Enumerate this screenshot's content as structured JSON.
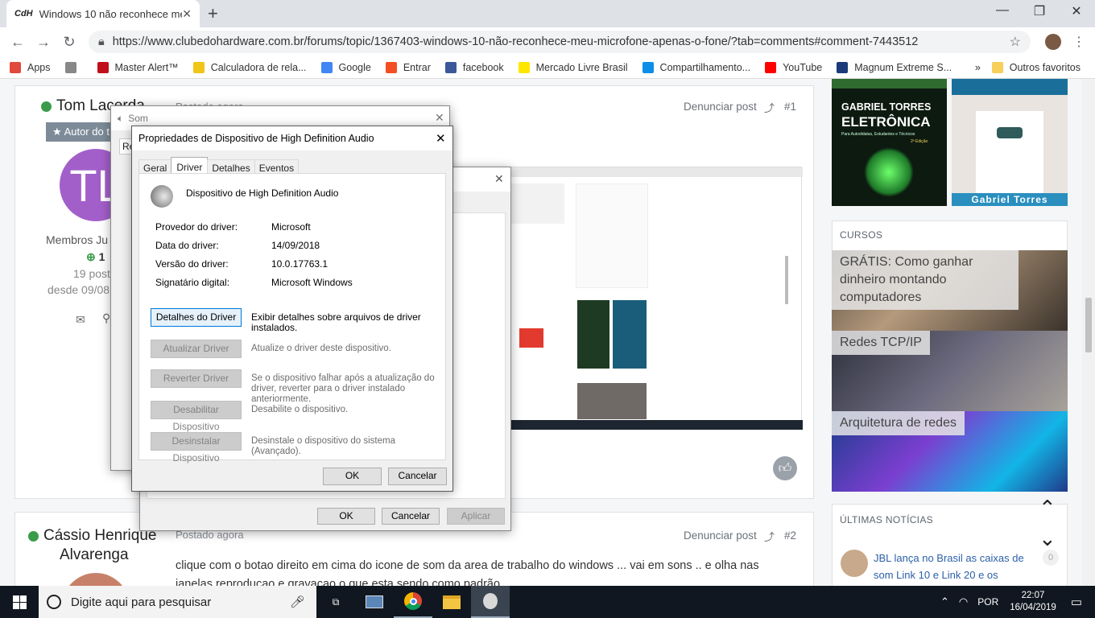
{
  "browser": {
    "tab_title": "Windows 10 não reconhece meu",
    "tab_favicon": "CdH",
    "url": "https://www.clubedohardware.com.br/forums/topic/1367403-windows-10-não-reconhece-meu-microfone-apenas-o-fone/?tab=comments#comment-7443512",
    "bookmarks": [
      {
        "label": "Apps",
        "icon": "apps-grid-icon",
        "color": "#e0493c"
      },
      {
        "label": "",
        "icon": "page-icon",
        "color": "#888888"
      },
      {
        "label": "Master Alert™",
        "icon": "master-alert-icon",
        "color": "#c0101a"
      },
      {
        "label": "Calculadora de rela...",
        "icon": "warning-icon",
        "color": "#f0c419"
      },
      {
        "label": "Google",
        "icon": "google-icon",
        "color": "#4285f4"
      },
      {
        "label": "Entrar",
        "icon": "windows-logo-icon",
        "color": "#f25022"
      },
      {
        "label": "facebook",
        "icon": "facebook-icon",
        "color": "#3b5998"
      },
      {
        "label": "Mercado Livre Brasil",
        "icon": "mercadolivre-icon",
        "color": "#ffe600"
      },
      {
        "label": "Compartilhamento...",
        "icon": "teamviewer-icon",
        "color": "#0e8ee9"
      },
      {
        "label": "YouTube",
        "icon": "youtube-icon",
        "color": "#ff0000"
      },
      {
        "label": "Magnum Extreme S...",
        "icon": "magnum-icon",
        "color": "#1a3a7a"
      }
    ],
    "bookmarks_overflow": "»",
    "other_favorites": "Outros favoritos"
  },
  "post1": {
    "author": "Tom Lacerda",
    "posted": "Postado agora",
    "badge": "Autor do t",
    "avatar_initials": "TL",
    "group": "Membros Ju",
    "reputation": "1",
    "posts": "19 post",
    "since": "desde 09/08",
    "report": "Denunciar post",
    "number": "#1"
  },
  "post2": {
    "author_line1": "Cássio Henrique",
    "author_line2": "Alvarenga",
    "posted": "Postado agora",
    "report": "Denunciar post",
    "number": "#2",
    "text_line1": "clique com o botao direito em cima do icone de som da area de trabalho do windows ... vai em sons .. e olha nas",
    "text_line2": "janelas reproducao e gravacao o que esta sendo como padrão"
  },
  "sidebar": {
    "book1_author": "GABRIEL TORRES",
    "book1_title": "ELETRÔNICA",
    "book1_sub": "Para Autodidatas, Estudantes e Técnicos",
    "book1_edition": "2ª Edição",
    "book2_author": "Gabriel Torres",
    "courses_title": "CURSOS",
    "courses": [
      "GRÁTIS: Como ganhar dinheiro montando computadores",
      "Redes TCP/IP",
      "Arquitetura de redes"
    ],
    "news_title": "ÚLTIMAS NOTÍCIAS",
    "news_item": "JBL lança no Brasil as caixas de som Link 10 e Link 20 e os",
    "news_count": "0"
  },
  "som_dialog": {
    "title": "Som",
    "tab_partial": "Re",
    "ok": "OK",
    "cancel": "Cancelar",
    "apply": "Aplicar"
  },
  "props_dialog": {
    "title": "Propriedades de Dispositivo de High Definition Audio",
    "tabs": [
      "Geral",
      "Driver",
      "Detalhes",
      "Eventos"
    ],
    "device_name": "Dispositivo de High Definition Audio",
    "rows": [
      {
        "label": "Provedor do driver:",
        "value": "Microsoft"
      },
      {
        "label": "Data do driver:",
        "value": "14/09/2018"
      },
      {
        "label": "Versão do driver:",
        "value": "10.0.17763.1"
      },
      {
        "label": "Signatário digital:",
        "value": "Microsoft Windows"
      }
    ],
    "actions": [
      {
        "button": "Detalhes do Driver",
        "desc": "Exibir detalhes sobre arquivos de driver instalados.",
        "enabled": true
      },
      {
        "button": "Atualizar Driver",
        "desc": "Atualize o driver deste dispositivo.",
        "enabled": false
      },
      {
        "button": "Reverter Driver",
        "desc": "Se o dispositivo falhar após a atualização do driver, reverter para o driver instalado anteriormente.",
        "enabled": false
      },
      {
        "button": "Desabilitar Dispositivo",
        "desc": "Desabilite o dispositivo.",
        "enabled": false
      },
      {
        "button": "Desinstalar Dispositivo",
        "desc": "Desinstale o dispositivo do sistema (Avançado).",
        "enabled": false
      }
    ],
    "ok": "OK",
    "cancel": "Cancelar"
  },
  "taskbar": {
    "search_placeholder": "Digite aqui para pesquisar",
    "language": "POR",
    "time": "22:07",
    "date": "16/04/2019"
  }
}
